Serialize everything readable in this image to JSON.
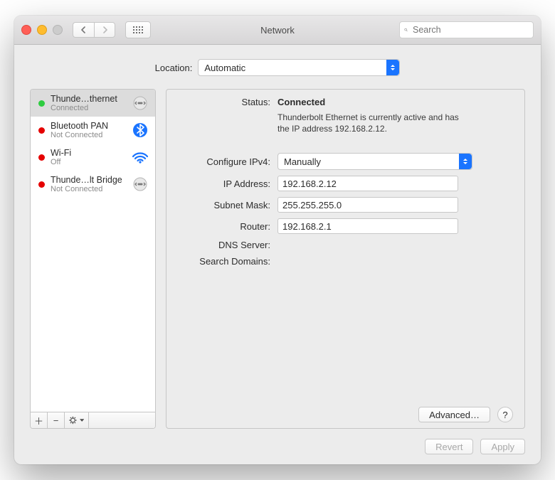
{
  "window": {
    "title": "Network"
  },
  "search": {
    "placeholder": "Search"
  },
  "location": {
    "label": "Location:",
    "value": "Automatic"
  },
  "services": [
    {
      "name": "Thunde…thernet",
      "sub": "Connected",
      "status": "green",
      "iconSemantic": "ethernet-icon"
    },
    {
      "name": "Bluetooth PAN",
      "sub": "Not Connected",
      "status": "red",
      "iconSemantic": "bluetooth-icon"
    },
    {
      "name": "Wi-Fi",
      "sub": "Off",
      "status": "red",
      "iconSemantic": "wifi-icon"
    },
    {
      "name": "Thunde…lt Bridge",
      "sub": "Not Connected",
      "status": "red",
      "iconSemantic": "ethernet-icon"
    }
  ],
  "detail": {
    "statusLabel": "Status:",
    "statusValue": "Connected",
    "statusDescription": "Thunderbolt Ethernet is currently active and has the IP address 192.168.2.12.",
    "configLabel": "Configure IPv4:",
    "configValue": "Manually",
    "ipLabel": "IP Address:",
    "ipValue": "192.168.2.12",
    "maskLabel": "Subnet Mask:",
    "maskValue": "255.255.255.0",
    "routerLabel": "Router:",
    "routerValue": "192.168.2.1",
    "dnsLabel": "DNS Server:",
    "dnsValue": "",
    "searchDomainsLabel": "Search Domains:",
    "searchDomainsValue": ""
  },
  "buttons": {
    "advanced": "Advanced…",
    "revert": "Revert",
    "apply": "Apply"
  },
  "footer": {
    "addTooltip": "Add service",
    "removeTooltip": "Remove service",
    "gearTooltip": "Service actions"
  }
}
